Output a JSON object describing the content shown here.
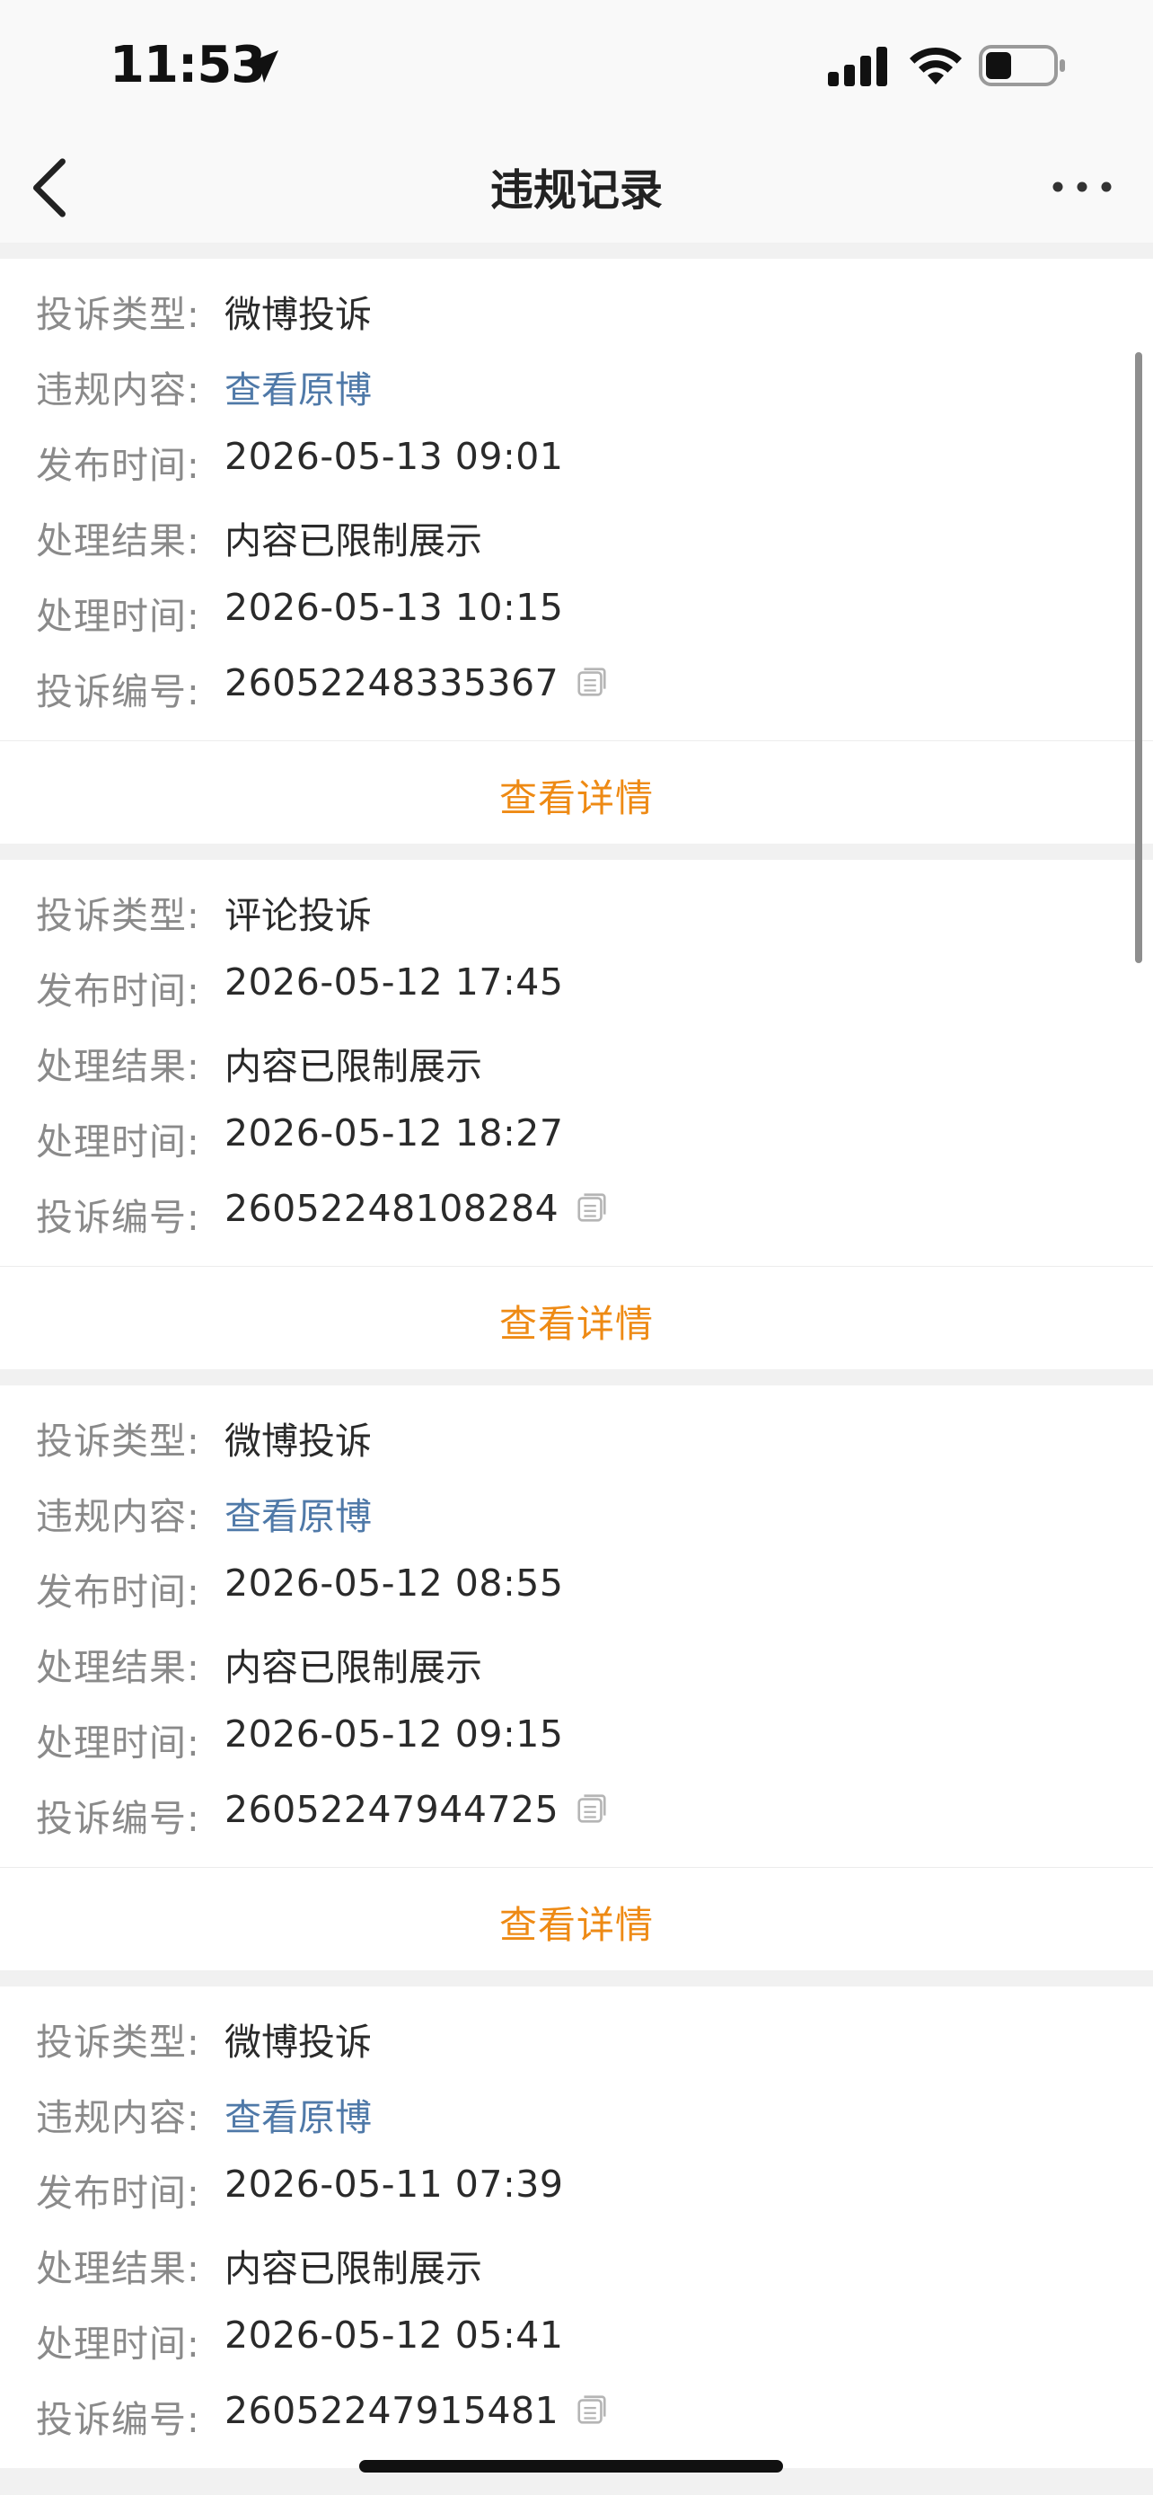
{
  "status_bar": {
    "time": "11:53"
  },
  "nav": {
    "title": "违规记录"
  },
  "labels": {
    "type": "投诉类型:",
    "content": "违规内容:",
    "publish": "发布时间:",
    "result": "处理结果:",
    "handle": "处理时间:",
    "number": "投诉编号:"
  },
  "records": [
    {
      "type": "微博投诉",
      "content_link": "查看原博",
      "publish_time": "2026-05-13 09:01",
      "result": "内容已限制展示",
      "handle_time": "2026-05-13 10:15",
      "number": "26052248335367",
      "detail": "查看详情"
    },
    {
      "type": "评论投诉",
      "publish_time": "2026-05-12 17:45",
      "result": "内容已限制展示",
      "handle_time": "2026-05-12 18:27",
      "number": "26052248108284",
      "detail": "查看详情"
    },
    {
      "type": "微博投诉",
      "content_link": "查看原博",
      "publish_time": "2026-05-12 08:55",
      "result": "内容已限制展示",
      "handle_time": "2026-05-12 09:15",
      "number": "26052247944725",
      "detail": "查看详情"
    },
    {
      "type": "微博投诉",
      "content_link": "查看原博",
      "publish_time": "2026-05-11 07:39",
      "result": "内容已限制展示",
      "handle_time": "2026-05-12 05:41",
      "number": "26052247915481"
    }
  ],
  "colors": {
    "link": "#4f79a8",
    "detail": "#ee8a14",
    "label": "#8a8a8a",
    "separator": "#f1f1f1"
  }
}
